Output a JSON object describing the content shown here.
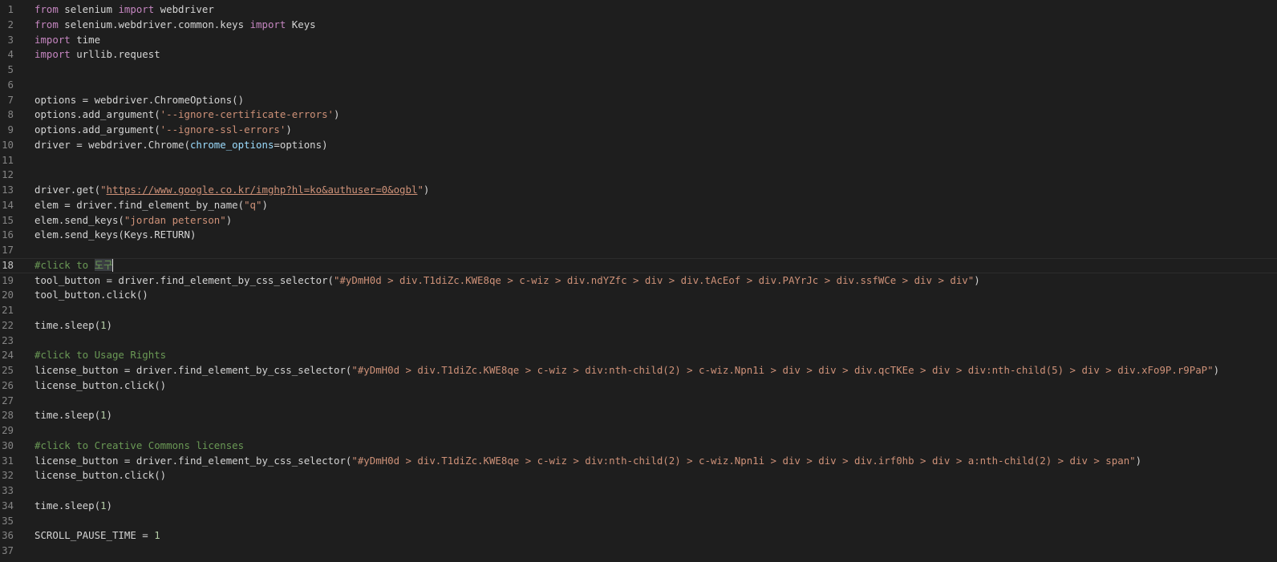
{
  "editor": {
    "current_line": 18,
    "lines": [
      {
        "n": "1",
        "tokens": [
          [
            "kw",
            "from"
          ],
          [
            "t",
            " selenium "
          ],
          [
            "kw",
            "import"
          ],
          [
            "t",
            " webdriver"
          ]
        ]
      },
      {
        "n": "2",
        "tokens": [
          [
            "kw",
            "from"
          ],
          [
            "t",
            " selenium.webdriver.common.keys "
          ],
          [
            "kw",
            "import"
          ],
          [
            "t",
            " Keys"
          ]
        ]
      },
      {
        "n": "3",
        "tokens": [
          [
            "kw",
            "import"
          ],
          [
            "t",
            " time"
          ]
        ]
      },
      {
        "n": "4",
        "tokens": [
          [
            "kw",
            "import"
          ],
          [
            "t",
            " urllib.request"
          ]
        ]
      },
      {
        "n": "5",
        "tokens": []
      },
      {
        "n": "6",
        "tokens": []
      },
      {
        "n": "7",
        "tokens": [
          [
            "t",
            "options = webdriver.ChromeOptions()"
          ]
        ]
      },
      {
        "n": "8",
        "tokens": [
          [
            "t",
            "options.add_argument("
          ],
          [
            "str",
            "'--ignore-certificate-errors'"
          ],
          [
            "t",
            ")"
          ]
        ]
      },
      {
        "n": "9",
        "tokens": [
          [
            "t",
            "options.add_argument("
          ],
          [
            "str",
            "'--ignore-ssl-errors'"
          ],
          [
            "t",
            ")"
          ]
        ]
      },
      {
        "n": "10",
        "tokens": [
          [
            "t",
            "driver = webdriver.Chrome("
          ],
          [
            "param",
            "chrome_options"
          ],
          [
            "t",
            "=options)"
          ]
        ]
      },
      {
        "n": "11",
        "tokens": []
      },
      {
        "n": "12",
        "tokens": []
      },
      {
        "n": "13",
        "tokens": [
          [
            "t",
            "driver.get("
          ],
          [
            "str",
            "\""
          ],
          [
            "strlink",
            "https://www.google.co.kr/imghp?hl=ko&authuser=0&ogbl"
          ],
          [
            "str",
            "\""
          ],
          [
            "t",
            ")"
          ]
        ]
      },
      {
        "n": "14",
        "tokens": [
          [
            "t",
            "elem = driver.find_element_by_name("
          ],
          [
            "str",
            "\"q\""
          ],
          [
            "t",
            ")"
          ]
        ]
      },
      {
        "n": "15",
        "tokens": [
          [
            "t",
            "elem.send_keys("
          ],
          [
            "str",
            "\"jordan peterson\""
          ],
          [
            "t",
            ")"
          ]
        ]
      },
      {
        "n": "16",
        "tokens": [
          [
            "t",
            "elem.send_keys(Keys.RETURN)"
          ]
        ]
      },
      {
        "n": "17",
        "tokens": []
      },
      {
        "n": "18",
        "tokens": [
          [
            "cmt",
            "#click to "
          ],
          [
            "cmt-hl",
            "도구"
          ],
          [
            "cursor",
            ""
          ]
        ]
      },
      {
        "n": "19",
        "tokens": [
          [
            "t",
            "tool_button = driver.find_element_by_css_selector("
          ],
          [
            "str",
            "\"#yDmH0d > div.T1diZc.KWE8qe > c-wiz > div.ndYZfc > div > div.tAcEof > div.PAYrJc > div.ssfWCe > div > div\""
          ],
          [
            "t",
            ")"
          ]
        ]
      },
      {
        "n": "20",
        "tokens": [
          [
            "t",
            "tool_button.click()"
          ]
        ]
      },
      {
        "n": "21",
        "tokens": []
      },
      {
        "n": "22",
        "tokens": [
          [
            "t",
            "time.sleep("
          ],
          [
            "num",
            "1"
          ],
          [
            "t",
            ")"
          ]
        ]
      },
      {
        "n": "23",
        "tokens": []
      },
      {
        "n": "24",
        "tokens": [
          [
            "cmt",
            "#click to Usage Rights"
          ]
        ]
      },
      {
        "n": "25",
        "tokens": [
          [
            "t",
            "license_button = driver.find_element_by_css_selector("
          ],
          [
            "str",
            "\"#yDmH0d > div.T1diZc.KWE8qe > c-wiz > div:nth-child(2) > c-wiz.Npn1i > div > div > div.qcTKEe > div > div:nth-child(5) > div > div.xFo9P.r9PaP\""
          ],
          [
            "t",
            ")"
          ]
        ]
      },
      {
        "n": "26",
        "tokens": [
          [
            "t",
            "license_button.click()"
          ]
        ]
      },
      {
        "n": "27",
        "tokens": []
      },
      {
        "n": "28",
        "tokens": [
          [
            "t",
            "time.sleep("
          ],
          [
            "num",
            "1"
          ],
          [
            "t",
            ")"
          ]
        ]
      },
      {
        "n": "29",
        "tokens": []
      },
      {
        "n": "30",
        "tokens": [
          [
            "cmt",
            "#click to Creative Commons licenses"
          ]
        ]
      },
      {
        "n": "31",
        "tokens": [
          [
            "t",
            "license_button = driver.find_element_by_css_selector("
          ],
          [
            "str",
            "\"#yDmH0d > div.T1diZc.KWE8qe > c-wiz > div:nth-child(2) > c-wiz.Npn1i > div > div > div.irf0hb > div > a:nth-child(2) > div > span\""
          ],
          [
            "t",
            ")"
          ]
        ]
      },
      {
        "n": "32",
        "tokens": [
          [
            "t",
            "license_button.click()"
          ]
        ]
      },
      {
        "n": "33",
        "tokens": []
      },
      {
        "n": "34",
        "tokens": [
          [
            "t",
            "time.sleep("
          ],
          [
            "num",
            "1"
          ],
          [
            "t",
            ")"
          ]
        ]
      },
      {
        "n": "35",
        "tokens": []
      },
      {
        "n": "36",
        "tokens": [
          [
            "t",
            "SCROLL_PAUSE_TIME = "
          ],
          [
            "num",
            "1"
          ]
        ]
      },
      {
        "n": "37",
        "tokens": []
      }
    ]
  }
}
